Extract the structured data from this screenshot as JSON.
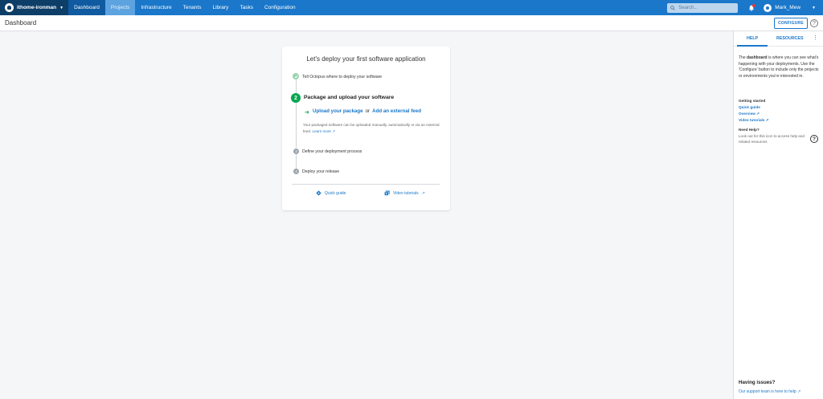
{
  "nav": {
    "space_name": "ithome-ironman",
    "items": [
      "Dashboard",
      "Projects",
      "Infrastructure",
      "Tenants",
      "Library",
      "Tasks",
      "Configuration"
    ],
    "search_placeholder": "Search...",
    "user_name": "Mark_Mew"
  },
  "header": {
    "title": "Dashboard",
    "configure_label": "CONFIGURE",
    "help_glyph": "?"
  },
  "card": {
    "title": "Let's deploy your first software application",
    "step1_label": "Tell Octopus where to deploy your software",
    "step2_number": "2",
    "step2_title": "Package and upload your software",
    "upload_link": "Upload your package",
    "or_text": "or",
    "external_feed_link": "Add an external feed",
    "description": "Your packaged software can be uploaded manually, automatically or via an external feed.",
    "learn_more": "Learn more",
    "step3_number": "3",
    "step3_label": "Define your deployment process",
    "step4_number": "4",
    "step4_label": "Deploy your release",
    "quick_guide": "Quick guide",
    "video_tutorials": "Video tutorials"
  },
  "help_pane": {
    "tab_help": "HELP",
    "tab_resources": "RESOURCES",
    "intro_bold": "dashboard",
    "intro_prefix": "The",
    "intro_rest": "is where you can see what's happening with your deployments. Use the 'Configure' button to include only the projects or environments you're interested in.",
    "getting_started": "Getting started",
    "quick_guide": "Quick guide",
    "overview": "Overview",
    "video_tutorials": "Video tutorials",
    "need_help": "Need Help?",
    "need_help_text": "Look out for this icon to access help and related resources",
    "help_icon_glyph": "?",
    "having_issues": "Having issues?",
    "support_link": "Our support team is here to help"
  },
  "colors": {
    "nav_bg": "#1a77ca",
    "accent_green": "#00a650",
    "link_blue": "#1a77ca"
  }
}
